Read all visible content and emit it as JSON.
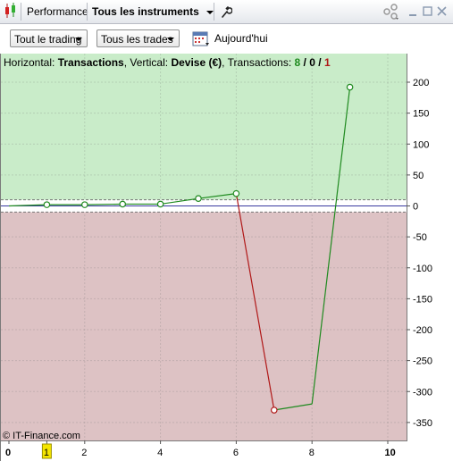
{
  "titlebar": {
    "performance_tab": "Performance",
    "instruments_tab": "Tous les instruments"
  },
  "toolbar": {
    "trading_dropdown": "Tout le trading",
    "trades_dropdown": "Tous les trades",
    "date_label": "Aujourd'hui"
  },
  "info": {
    "horizontal_label": "Horizontal:",
    "horizontal_value": "Transactions",
    "vertical_label": ", Vertical:",
    "vertical_value": "Devise (€)",
    "count_label": ", Transactions:",
    "count_win": "8",
    "count_sep1": " / ",
    "count_even": "0",
    "count_sep2": " / ",
    "count_loss": "1"
  },
  "copyright": "© IT-Finance.com",
  "colors": {
    "profit_zone": "#c9ecc9",
    "loss_zone": "#ddc2c4",
    "up_line": "#1f8a1f",
    "down_line": "#b01818",
    "zero_line": "#3a3aa0",
    "highlight_tick": "#f5e600"
  },
  "chart_data": {
    "type": "line",
    "x": [
      0,
      1,
      2,
      3,
      4,
      5,
      6,
      7,
      8,
      9
    ],
    "values": [
      0,
      2,
      2,
      3,
      3,
      12,
      20,
      -330,
      -320,
      192
    ],
    "markers": [
      1,
      2,
      3,
      4,
      5,
      6,
      7,
      9
    ],
    "xlim": [
      0,
      10.6
    ],
    "ylim": [
      -375,
      245
    ],
    "x_ticks": [
      "0",
      "1",
      "2",
      "4",
      "6",
      "8",
      "10"
    ],
    "x_tick_values": [
      0,
      1,
      2,
      4,
      6,
      8,
      10
    ],
    "highlighted_x_tick": "1",
    "y_ticks": [
      200,
      150,
      100,
      50,
      0,
      -50,
      -100,
      -150,
      -200,
      -250,
      -300,
      -350
    ],
    "threshold_band": [
      10,
      -10
    ],
    "grid": true
  }
}
